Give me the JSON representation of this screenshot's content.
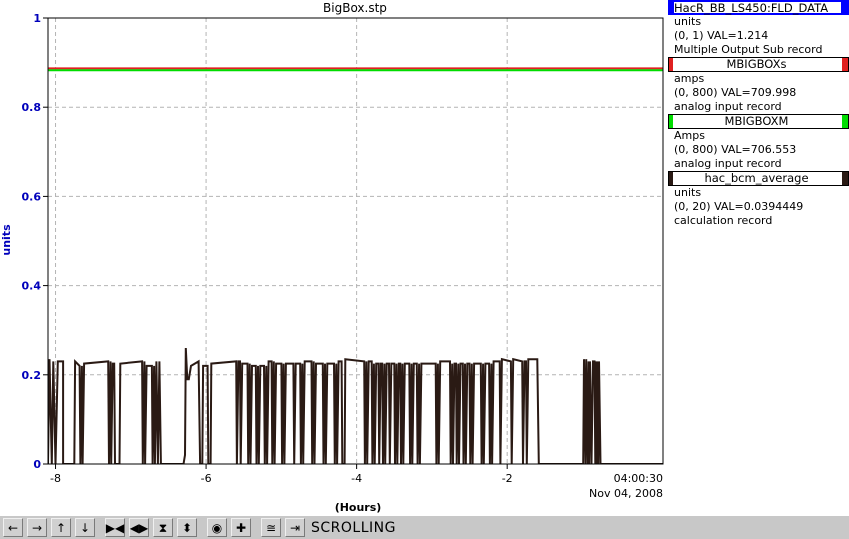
{
  "chart_data": {
    "type": "line",
    "title": "BigBox.stp",
    "xlabel": "(Hours)",
    "ylabel": "units",
    "xlim": [
      -8.1,
      0.07
    ],
    "ylim": [
      0,
      1
    ],
    "x_ticks": [
      "-8",
      "-6",
      "-4",
      "-2"
    ],
    "x_tick_values": [
      -8,
      -6,
      -4,
      -2
    ],
    "y_ticks": [
      "0",
      "0.2",
      "0.4",
      "0.6",
      "0.8",
      "1"
    ],
    "y_tick_values": [
      0,
      0.2,
      0.4,
      0.6,
      0.8,
      1
    ],
    "end_time": "04:00:30",
    "end_date": "Nov 04, 2008",
    "grid": true,
    "series": [
      {
        "name": "HacR_BB_LS450:FLD_DATA",
        "color": "#0000ff",
        "points": [
          [
            -8.1,
            1.214
          ],
          [
            0.07,
            1.214
          ]
        ]
      },
      {
        "name": "MBIGBOXs",
        "color": "#e02020",
        "points": [
          [
            -8.1,
            0.887
          ],
          [
            0.07,
            0.887
          ]
        ]
      },
      {
        "name": "MBIGBOXM",
        "color": "#00dd00",
        "points": [
          [
            -8.1,
            0.883
          ],
          [
            0.07,
            0.883
          ]
        ]
      },
      {
        "name": "hac_bcm_average",
        "color": "#2a1a14",
        "points": [
          [
            -8.1,
            0.0
          ],
          [
            -8.08,
            0.235
          ],
          [
            -8.05,
            0.0
          ],
          [
            -8.03,
            0.23
          ],
          [
            -8.0,
            0.0
          ],
          [
            -7.97,
            0.23
          ],
          [
            -7.9,
            0.23
          ],
          [
            -7.9,
            0.0
          ],
          [
            -7.75,
            0.0
          ],
          [
            -7.74,
            0.23
          ],
          [
            -7.68,
            0.22
          ],
          [
            -7.67,
            0.0
          ],
          [
            -7.65,
            0.22
          ],
          [
            -7.64,
            0.0
          ],
          [
            -7.62,
            0.225
          ],
          [
            -7.3,
            0.23
          ],
          [
            -7.29,
            0.0
          ],
          [
            -7.27,
            0.23
          ],
          [
            -7.26,
            0.0
          ],
          [
            -7.24,
            0.225
          ],
          [
            -7.22,
            0.225
          ],
          [
            -7.21,
            0.0
          ],
          [
            -7.15,
            0.0
          ],
          [
            -7.14,
            0.225
          ],
          [
            -6.85,
            0.23
          ],
          [
            -6.84,
            0.0
          ],
          [
            -6.82,
            0.23
          ],
          [
            -6.81,
            0.0
          ],
          [
            -6.79,
            0.22
          ],
          [
            -6.72,
            0.22
          ],
          [
            -6.71,
            0.0
          ],
          [
            -6.69,
            0.22
          ],
          [
            -6.68,
            0.0
          ],
          [
            -6.66,
            0.23
          ],
          [
            -6.64,
            0.0
          ],
          [
            -6.62,
            0.23
          ],
          [
            -6.6,
            0.0
          ],
          [
            -6.3,
            0.0
          ],
          [
            -6.28,
            0.02
          ],
          [
            -6.27,
            0.26
          ],
          [
            -6.25,
            0.19
          ],
          [
            -6.23,
            0.19
          ],
          [
            -6.2,
            0.22
          ],
          [
            -6.1,
            0.23
          ],
          [
            -6.08,
            0.0
          ],
          [
            -6.05,
            0.0
          ],
          [
            -6.04,
            0.22
          ],
          [
            -5.98,
            0.22
          ],
          [
            -5.97,
            0.0
          ],
          [
            -5.94,
            0.0
          ],
          [
            -5.93,
            0.225
          ],
          [
            -5.6,
            0.23
          ],
          [
            -5.59,
            0.0
          ],
          [
            -5.57,
            0.23
          ],
          [
            -5.55,
            0.23
          ],
          [
            -5.54,
            0.0
          ],
          [
            -5.52,
            0.225
          ],
          [
            -5.45,
            0.225
          ],
          [
            -5.44,
            0.0
          ],
          [
            -5.42,
            0.225
          ],
          [
            -5.41,
            0.0
          ],
          [
            -5.39,
            0.22
          ],
          [
            -5.34,
            0.22
          ],
          [
            -5.33,
            0.0
          ],
          [
            -5.31,
            0.22
          ],
          [
            -5.3,
            0.0
          ],
          [
            -5.28,
            0.22
          ],
          [
            -5.23,
            0.22
          ],
          [
            -5.22,
            0.0
          ],
          [
            -5.2,
            0.22
          ],
          [
            -5.19,
            0.0
          ],
          [
            -5.17,
            0.23
          ],
          [
            -5.13,
            0.23
          ],
          [
            -5.12,
            0.0
          ],
          [
            -5.1,
            0.23
          ],
          [
            -5.09,
            0.0
          ],
          [
            -5.07,
            0.225
          ],
          [
            -5.0,
            0.225
          ],
          [
            -4.99,
            0.0
          ],
          [
            -4.97,
            0.225
          ],
          [
            -4.96,
            0.0
          ],
          [
            -4.94,
            0.225
          ],
          [
            -4.84,
            0.225
          ],
          [
            -4.83,
            0.0
          ],
          [
            -4.81,
            0.225
          ],
          [
            -4.75,
            0.225
          ],
          [
            -4.74,
            0.0
          ],
          [
            -4.72,
            0.225
          ],
          [
            -4.71,
            0.0
          ],
          [
            -4.69,
            0.23
          ],
          [
            -4.6,
            0.23
          ],
          [
            -4.59,
            0.0
          ],
          [
            -4.57,
            0.23
          ],
          [
            -4.56,
            0.0
          ],
          [
            -4.54,
            0.225
          ],
          [
            -4.45,
            0.225
          ],
          [
            -4.44,
            0.0
          ],
          [
            -4.42,
            0.225
          ],
          [
            -4.41,
            0.0
          ],
          [
            -4.39,
            0.225
          ],
          [
            -4.3,
            0.225
          ],
          [
            -4.29,
            0.0
          ],
          [
            -4.27,
            0.225
          ],
          [
            -4.26,
            0.0
          ],
          [
            -4.24,
            0.23
          ],
          [
            -4.2,
            0.23
          ],
          [
            -4.19,
            0.0
          ],
          [
            -4.16,
            0.0
          ],
          [
            -4.15,
            0.235
          ],
          [
            -3.9,
            0.23
          ],
          [
            -3.89,
            0.0
          ],
          [
            -3.87,
            0.23
          ],
          [
            -3.86,
            0.0
          ],
          [
            -3.84,
            0.23
          ],
          [
            -3.8,
            0.23
          ],
          [
            -3.79,
            0.0
          ],
          [
            -3.77,
            0.225
          ],
          [
            -3.76,
            0.0
          ],
          [
            -3.74,
            0.225
          ],
          [
            -3.71,
            0.225
          ],
          [
            -3.7,
            0.0
          ],
          [
            -3.68,
            0.225
          ],
          [
            -3.66,
            0.225
          ],
          [
            -3.65,
            0.0
          ],
          [
            -3.63,
            0.225
          ],
          [
            -3.62,
            0.0
          ],
          [
            -3.6,
            0.225
          ],
          [
            -3.57,
            0.225
          ],
          [
            -3.56,
            0.0
          ],
          [
            -3.54,
            0.225
          ],
          [
            -3.5,
            0.225
          ],
          [
            -3.49,
            0.0
          ],
          [
            -3.47,
            0.225
          ],
          [
            -3.46,
            0.0
          ],
          [
            -3.44,
            0.225
          ],
          [
            -3.42,
            0.225
          ],
          [
            -3.41,
            0.0
          ],
          [
            -3.39,
            0.225
          ],
          [
            -3.38,
            0.0
          ],
          [
            -3.36,
            0.225
          ],
          [
            -3.3,
            0.225
          ],
          [
            -3.29,
            0.0
          ],
          [
            -3.27,
            0.225
          ],
          [
            -3.26,
            0.0
          ],
          [
            -3.24,
            0.225
          ],
          [
            -3.2,
            0.225
          ],
          [
            -3.19,
            0.0
          ],
          [
            -3.17,
            0.225
          ],
          [
            -3.16,
            0.0
          ],
          [
            -3.14,
            0.225
          ],
          [
            -2.95,
            0.225
          ],
          [
            -2.94,
            0.0
          ],
          [
            -2.92,
            0.225
          ],
          [
            -2.91,
            0.0
          ],
          [
            -2.89,
            0.23
          ],
          [
            -2.76,
            0.23
          ],
          [
            -2.75,
            0.0
          ],
          [
            -2.73,
            0.225
          ],
          [
            -2.72,
            0.0
          ],
          [
            -2.7,
            0.225
          ],
          [
            -2.68,
            0.225
          ],
          [
            -2.67,
            0.0
          ],
          [
            -2.65,
            0.225
          ],
          [
            -2.64,
            0.0
          ],
          [
            -2.62,
            0.225
          ],
          [
            -2.59,
            0.225
          ],
          [
            -2.58,
            0.0
          ],
          [
            -2.56,
            0.225
          ],
          [
            -2.55,
            0.0
          ],
          [
            -2.53,
            0.225
          ],
          [
            -2.5,
            0.225
          ],
          [
            -2.49,
            0.0
          ],
          [
            -2.47,
            0.225
          ],
          [
            -2.46,
            0.0
          ],
          [
            -2.44,
            0.225
          ],
          [
            -2.35,
            0.225
          ],
          [
            -2.34,
            0.0
          ],
          [
            -2.32,
            0.225
          ],
          [
            -2.31,
            0.0
          ],
          [
            -2.29,
            0.225
          ],
          [
            -2.24,
            0.225
          ],
          [
            -2.23,
            0.0
          ],
          [
            -2.21,
            0.225
          ],
          [
            -2.2,
            0.0
          ],
          [
            -2.18,
            0.23
          ],
          [
            -2.1,
            0.23
          ],
          [
            -2.09,
            0.0
          ],
          [
            -2.07,
            0.235
          ],
          [
            -1.95,
            0.23
          ],
          [
            -1.94,
            0.0
          ],
          [
            -1.92,
            0.235
          ],
          [
            -1.8,
            0.23
          ],
          [
            -1.79,
            0.0
          ],
          [
            -1.77,
            0.23
          ],
          [
            -1.75,
            0.23
          ],
          [
            -1.74,
            0.0
          ],
          [
            -1.72,
            0.235
          ],
          [
            -1.6,
            0.235
          ],
          [
            -1.58,
            0.0
          ],
          [
            -1.48,
            0.0
          ],
          [
            -0.99,
            0.0
          ],
          [
            -0.98,
            0.235
          ],
          [
            -0.96,
            0.0
          ],
          [
            -0.95,
            0.235
          ],
          [
            -0.93,
            0.0
          ],
          [
            -0.92,
            0.23
          ],
          [
            -0.91,
            0.0
          ],
          [
            -0.9,
            0.23
          ],
          [
            -0.88,
            0.0
          ],
          [
            -0.86,
            0.23
          ],
          [
            -0.84,
            0.23
          ],
          [
            -0.83,
            0.0
          ],
          [
            -0.82,
            0.23
          ],
          [
            -0.81,
            0.0
          ],
          [
            -0.8,
            0.23
          ],
          [
            -0.79,
            0.0
          ],
          [
            -0.78,
            0.23
          ],
          [
            -0.76,
            0.0
          ],
          [
            -0.74,
            0.0
          ],
          [
            0.07,
            0.0
          ]
        ]
      }
    ]
  },
  "legend": [
    {
      "name": "HacR_BB_LS450:FLD_DATA",
      "color": "#0000ff",
      "units": "units",
      "range": "(0, 1) VAL=1.214",
      "record": "Multiple Output Sub record"
    },
    {
      "name": "MBIGBOXs",
      "color": "#e02020",
      "units": "amps",
      "range": "(0, 800) VAL=709.998",
      "record": "analog input record"
    },
    {
      "name": "MBIGBOXM",
      "color": "#00dd00",
      "units": "Amps",
      "range": "(0, 800) VAL=706.553",
      "record": "analog input record"
    },
    {
      "name": "hac_bcm_average",
      "color": "#2a1a14",
      "units": "units",
      "range": "(0, 20) VAL=0.0394449",
      "record": "calculation record"
    }
  ],
  "toolbar": {
    "buttons": [
      {
        "name": "scroll-left-icon",
        "glyph": "←"
      },
      {
        "name": "scroll-right-icon",
        "glyph": "→"
      },
      {
        "name": "scroll-up-icon",
        "glyph": "↑"
      },
      {
        "name": "scroll-down-icon",
        "glyph": "↓"
      },
      {
        "name": "expand-horizontal-icon",
        "glyph": "▶◀"
      },
      {
        "name": "compress-horizontal-icon",
        "glyph": "◀▶"
      },
      {
        "name": "expand-vertical-icon",
        "glyph": "⧗"
      },
      {
        "name": "compress-vertical-icon",
        "glyph": "⬍"
      },
      {
        "name": "zoom-out-icon",
        "glyph": "◉"
      },
      {
        "name": "zoom-in-icon",
        "glyph": "✚"
      },
      {
        "name": "autoscale-icon",
        "glyph": "≅"
      },
      {
        "name": "resume-scroll-icon",
        "glyph": "⇥"
      }
    ],
    "status": "SCROLLING"
  }
}
